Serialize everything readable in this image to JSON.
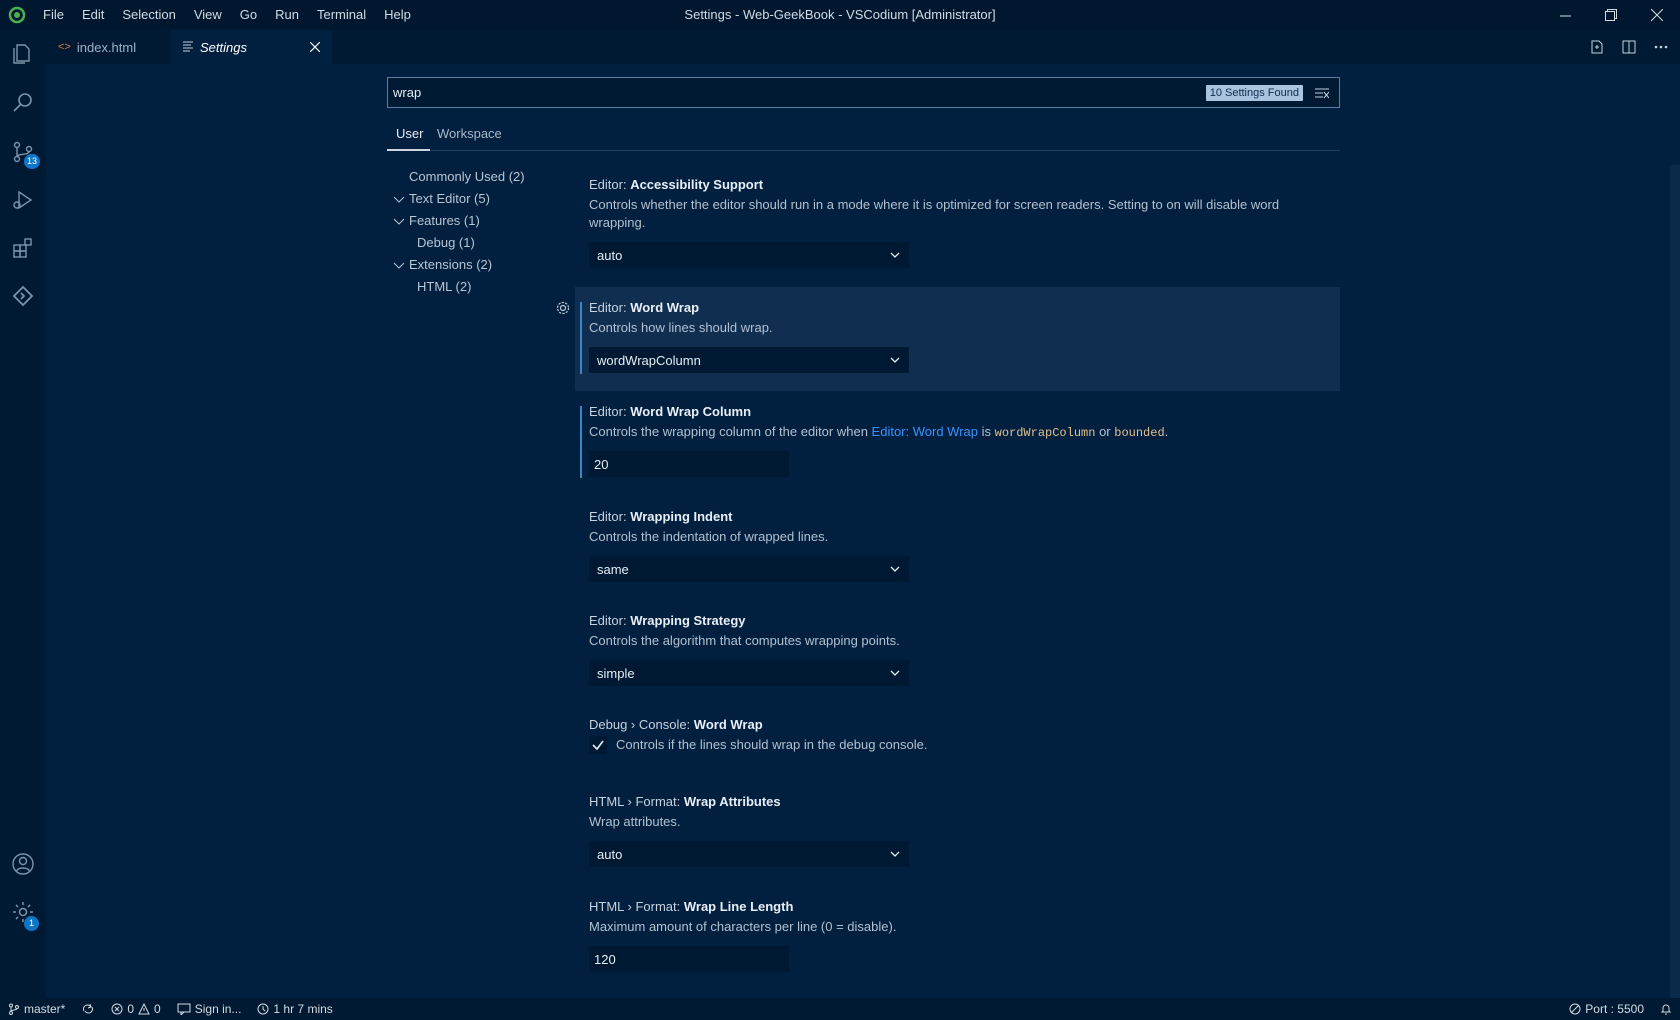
{
  "window": {
    "title": "Settings - Web-GeekBook - VSCodium [Administrator]",
    "menu": [
      "File",
      "Edit",
      "Selection",
      "View",
      "Go",
      "Run",
      "Terminal",
      "Help"
    ]
  },
  "activity": {
    "scm_badge": "13",
    "settings_badge": "1"
  },
  "tabs": {
    "index": "index.html",
    "settings": "Settings"
  },
  "search": {
    "value": "wrap",
    "found": "10 Settings Found"
  },
  "scope": {
    "user": "User",
    "workspace": "Workspace"
  },
  "toc": {
    "commonly_used": "Commonly Used (2)",
    "text_editor": "Text Editor (5)",
    "features": "Features (1)",
    "debug": "Debug (1)",
    "extensions": "Extensions (2)",
    "html": "HTML (2)"
  },
  "settings": {
    "s1": {
      "prefix": "Editor: ",
      "name": "Accessibility Support",
      "desc": "Controls whether the editor should run in a mode where it is optimized for screen readers. Setting to on will disable word wrapping.",
      "value": "auto"
    },
    "s2": {
      "prefix": "Editor: ",
      "name": "Word Wrap",
      "desc": "Controls how lines should wrap.",
      "value": "wordWrapColumn"
    },
    "s3": {
      "prefix": "Editor: ",
      "name": "Word Wrap Column",
      "desc_pre": "Controls the wrapping column of the editor when ",
      "desc_link": "Editor: Word Wrap",
      "desc_mid": " is ",
      "code1": "wordWrapColumn",
      "desc_or": " or ",
      "code2": "bounded",
      "desc_end": ".",
      "value": "20"
    },
    "s4": {
      "prefix": "Editor: ",
      "name": "Wrapping Indent",
      "desc": "Controls the indentation of wrapped lines.",
      "value": "same"
    },
    "s5": {
      "prefix": "Editor: ",
      "name": "Wrapping Strategy",
      "desc": "Controls the algorithm that computes wrapping points.",
      "value": "simple"
    },
    "s6": {
      "prefix": "Debug › Console: ",
      "name": "Word Wrap",
      "desc": "Controls if the lines should wrap in the debug console.",
      "checked": true
    },
    "s7": {
      "prefix": "HTML › Format: ",
      "name": "Wrap Attributes",
      "desc": "Wrap attributes.",
      "value": "auto"
    },
    "s8": {
      "prefix": "HTML › Format: ",
      "name": "Wrap Line Length",
      "desc": "Maximum amount of characters per line (0 = disable).",
      "value": "120"
    }
  },
  "status": {
    "branch": "master*",
    "errors": "0",
    "warnings": "0",
    "sign_in": "Sign in...",
    "time": "1 hr 7 mins",
    "port": "Port : 5500"
  },
  "colors": {
    "background": "#011f3f",
    "link": "#3794ff",
    "badge": "#0e76c9"
  }
}
